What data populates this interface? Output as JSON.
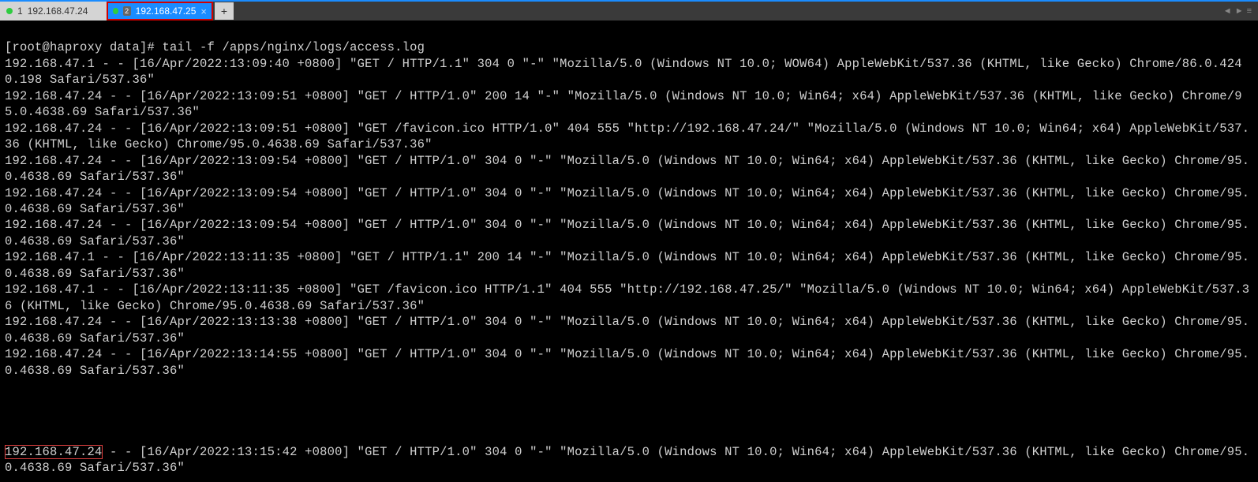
{
  "tabs": [
    {
      "index": "1",
      "label": "192.168.47.24",
      "active": false
    },
    {
      "index": "2",
      "badge": "2",
      "label": "192.168.47.25",
      "active": true
    }
  ],
  "add_tab": "+",
  "prompt": "[root@haproxy data]# tail -f /apps/nginx/logs/access.log",
  "log_lines": [
    "192.168.47.1 - - [16/Apr/2022:13:09:40 +0800] \"GET / HTTP/1.1\" 304 0 \"-\" \"Mozilla/5.0 (Windows NT 10.0; WOW64) AppleWebKit/537.36 (KHTML, like Gecko) Chrome/86.0.4240.198 Safari/537.36\"",
    "192.168.47.24 - - [16/Apr/2022:13:09:51 +0800] \"GET / HTTP/1.0\" 200 14 \"-\" \"Mozilla/5.0 (Windows NT 10.0; Win64; x64) AppleWebKit/537.36 (KHTML, like Gecko) Chrome/95.0.4638.69 Safari/537.36\"",
    "192.168.47.24 - - [16/Apr/2022:13:09:51 +0800] \"GET /favicon.ico HTTP/1.0\" 404 555 \"http://192.168.47.24/\" \"Mozilla/5.0 (Windows NT 10.0; Win64; x64) AppleWebKit/537.36 (KHTML, like Gecko) Chrome/95.0.4638.69 Safari/537.36\"",
    "192.168.47.24 - - [16/Apr/2022:13:09:54 +0800] \"GET / HTTP/1.0\" 304 0 \"-\" \"Mozilla/5.0 (Windows NT 10.0; Win64; x64) AppleWebKit/537.36 (KHTML, like Gecko) Chrome/95.0.4638.69 Safari/537.36\"",
    "192.168.47.24 - - [16/Apr/2022:13:09:54 +0800] \"GET / HTTP/1.0\" 304 0 \"-\" \"Mozilla/5.0 (Windows NT 10.0; Win64; x64) AppleWebKit/537.36 (KHTML, like Gecko) Chrome/95.0.4638.69 Safari/537.36\"",
    "192.168.47.24 - - [16/Apr/2022:13:09:54 +0800] \"GET / HTTP/1.0\" 304 0 \"-\" \"Mozilla/5.0 (Windows NT 10.0; Win64; x64) AppleWebKit/537.36 (KHTML, like Gecko) Chrome/95.0.4638.69 Safari/537.36\"",
    "192.168.47.1 - - [16/Apr/2022:13:11:35 +0800] \"GET / HTTP/1.1\" 200 14 \"-\" \"Mozilla/5.0 (Windows NT 10.0; Win64; x64) AppleWebKit/537.36 (KHTML, like Gecko) Chrome/95.0.4638.69 Safari/537.36\"",
    "192.168.47.1 - - [16/Apr/2022:13:11:35 +0800] \"GET /favicon.ico HTTP/1.1\" 404 555 \"http://192.168.47.25/\" \"Mozilla/5.0 (Windows NT 10.0; Win64; x64) AppleWebKit/537.36 (KHTML, like Gecko) Chrome/95.0.4638.69 Safari/537.36\"",
    "192.168.47.24 - - [16/Apr/2022:13:13:38 +0800] \"GET / HTTP/1.0\" 304 0 \"-\" \"Mozilla/5.0 (Windows NT 10.0; Win64; x64) AppleWebKit/537.36 (KHTML, like Gecko) Chrome/95.0.4638.69 Safari/537.36\"",
    "192.168.47.24 - - [16/Apr/2022:13:14:55 +0800] \"GET / HTTP/1.0\" 304 0 \"-\" \"Mozilla/5.0 (Windows NT 10.0; Win64; x64) AppleWebKit/537.36 (KHTML, like Gecko) Chrome/95.0.4638.69 Safari/537.36\""
  ],
  "highlighted_line": {
    "prefix_ip": "192.168.47.24",
    "rest": " - - [16/Apr/2022:13:15:42 +0800] \"GET / HTTP/1.0\" 304 0 \"-\" \"Mozilla/5.0 (Windows NT 10.0; Win64; x64) AppleWebKit/537.36 (KHTML, like Gecko) Chrome/95.0.4638.69 Safari/537.36\""
  }
}
